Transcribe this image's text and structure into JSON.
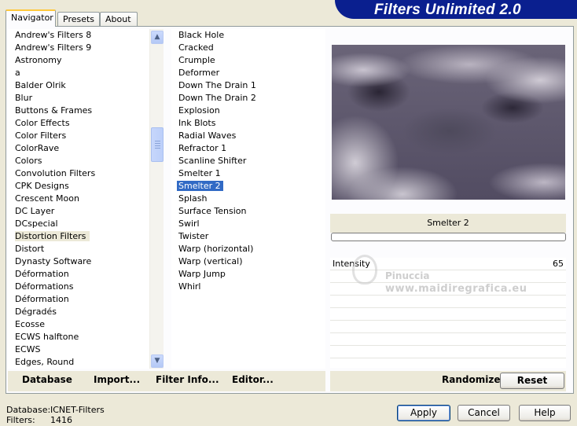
{
  "tabs": [
    "Navigator",
    "Presets",
    "About"
  ],
  "banner_title": "Filters Unlimited 2.0",
  "categories": [
    "Andrew's Filters 8",
    "Andrew's Filters 9",
    "Astronomy",
    "a",
    "Balder Olrik",
    "Blur",
    "Buttons & Frames",
    "Color Effects",
    "Color Filters",
    "ColorRave",
    "Colors",
    "Convolution Filters",
    "CPK Designs",
    "Crescent Moon",
    "DC Layer",
    "DCspecial",
    "Distortion Filters",
    "Distort",
    "Dynasty Software",
    "Déformation",
    "Déformations",
    "Déformation",
    "Dégradés",
    "Ecosse",
    "ECWS halftone",
    "ECWS",
    "Edges, Round"
  ],
  "selected_category": "Distortion Filters",
  "filters": [
    "Black Hole",
    "Cracked",
    "Crumple",
    "Deformer",
    "Down The Drain 1",
    "Down The Drain 2",
    "Explosion",
    "Ink Blots",
    "Radial Waves",
    "Refractor 1",
    "Scanline Shifter",
    "Smelter 1",
    "Smelter 2",
    "Splash",
    "Surface Tension",
    "Swirl",
    "Twister",
    "Warp (horizontal)",
    "Warp (vertical)",
    "Warp Jump",
    "Whirl"
  ],
  "selected_filter": "Smelter 2",
  "filter_name": "Smelter 2",
  "params": [
    {
      "name": "Intensity",
      "value": "65"
    },
    {
      "name": "",
      "value": ""
    },
    {
      "name": "",
      "value": ""
    },
    {
      "name": "",
      "value": ""
    },
    {
      "name": "",
      "value": ""
    },
    {
      "name": "",
      "value": ""
    },
    {
      "name": "",
      "value": ""
    },
    {
      "name": "",
      "value": ""
    }
  ],
  "watermark": {
    "name": "Pinuccia",
    "url": "www.maidiregrafica.eu"
  },
  "toolbar": {
    "database": "Database",
    "import": "Import...",
    "filter_info": "Filter Info...",
    "editor": "Editor...",
    "randomize": "Randomize",
    "reset": "Reset"
  },
  "status": {
    "database_label": "Database:",
    "database_value": "ICNET-Filters",
    "filters_label": "Filters:",
    "filters_value": "1416"
  },
  "buttons": {
    "apply": "Apply",
    "cancel": "Cancel",
    "help": "Help"
  },
  "colors": {
    "accent": "#316ac5",
    "banner": "#0a1f8f",
    "tab_highlight": "#ffc83c"
  }
}
